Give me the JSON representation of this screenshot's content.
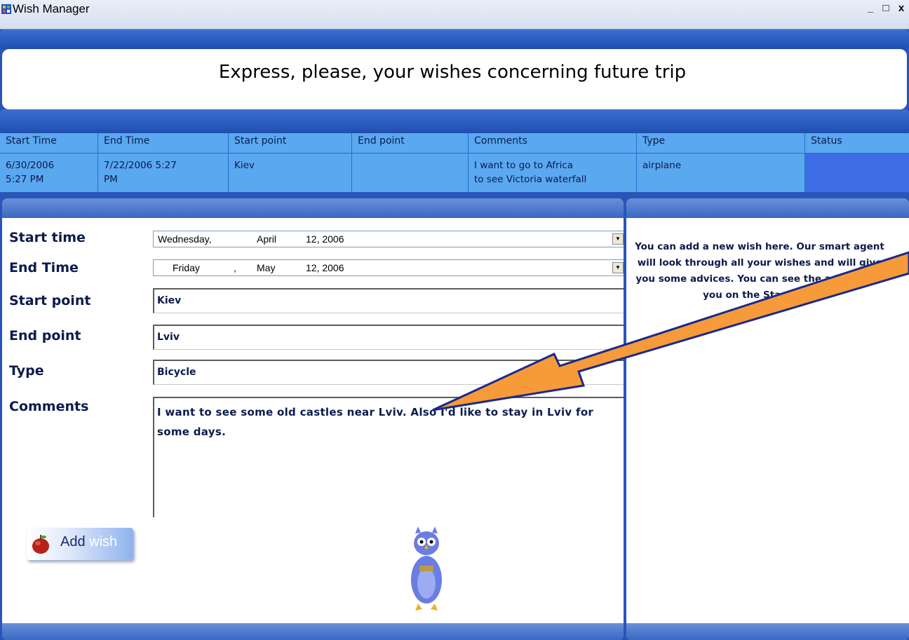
{
  "window": {
    "title": "Wish Manager",
    "controls": {
      "minimize": "_",
      "maximize": "□",
      "close": "x"
    }
  },
  "header": {
    "text": "Express, please, your wishes concerning future trip"
  },
  "grid": {
    "columns": [
      "Start Time",
      "End Time",
      "Start point",
      "End point",
      "Comments",
      "Type",
      "Status"
    ],
    "rows": [
      {
        "start_time": "6/30/2006\n5:27 PM",
        "end_time": "7/22/2006 5:27\nPM",
        "start_point": "Kiev",
        "end_point": "",
        "comments": "I want to go to Africa\nto see Victoria waterfall",
        "type": "airplane",
        "status": ""
      }
    ]
  },
  "form": {
    "labels": {
      "start_time": "Start time",
      "end_time": "End Time",
      "start_point": "Start point",
      "end_point": "End point",
      "type": "Type",
      "comments": "Comments"
    },
    "start_date": {
      "weekday": "Wednesday,",
      "month": "April",
      "day_year": "12, 2006"
    },
    "end_date": {
      "weekday": "Friday",
      "sep": ",",
      "month": "May",
      "day_year": "12, 2006"
    },
    "start_point_value": "Kiev",
    "end_point_value": "Lviv",
    "type_value": "Bicycle",
    "comments_value": "I want to see some old castles near Lviv. Also I'd like to stay in Lviv for some days.",
    "add_button": {
      "part1": "Add",
      "part2": "wish"
    }
  },
  "hint": {
    "text": "You can add a new wish here. Our smart agent will look through all your wishes and will give you some advices. You can see the advices for you on the StartPage"
  },
  "colors": {
    "accent": "#3b6ed2",
    "grid": "#5aa8f0",
    "arrow": "#f79a3a"
  },
  "icons": [
    "app-icon",
    "apple-icon",
    "owl-mascot",
    "dropdown-arrow-icon"
  ]
}
